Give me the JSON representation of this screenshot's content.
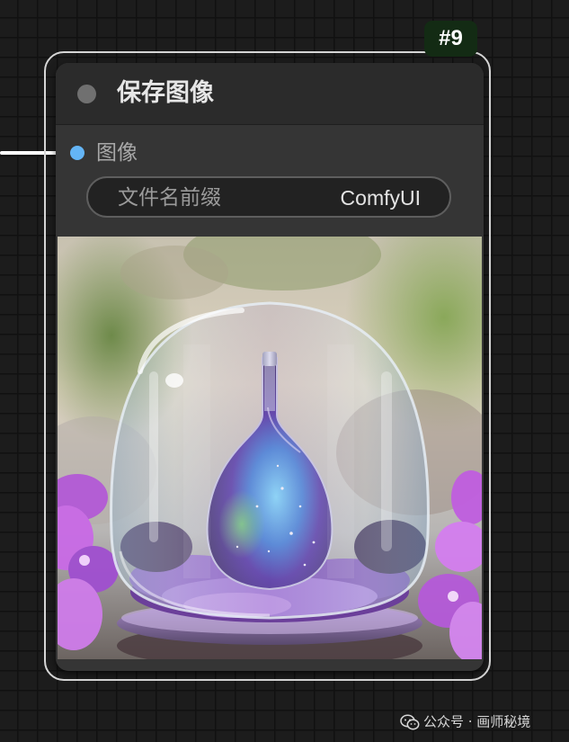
{
  "node": {
    "badge": "#9",
    "title": "保存图像",
    "input": {
      "label": "图像",
      "color": "#64b5f6"
    },
    "widget": {
      "label": "文件名前缀",
      "value": "ComfyUI"
    },
    "preview": {
      "image": "bottle-in-glass-dome"
    }
  },
  "link_color": "#ffffff",
  "watermark": {
    "icon": "wechat-icon",
    "text": "公众号 · 画师秘境"
  }
}
